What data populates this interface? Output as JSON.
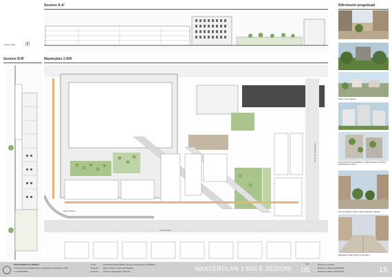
{
  "headings": {
    "section_aa": "Sezione A-A'",
    "references": "Riferimenti progettuali",
    "section_bb": "Sezione B-B'",
    "masterplan": "Masterplan 1:500"
  },
  "scale_label": "Scala 1:500",
  "references": [
    {
      "caption": ""
    },
    {
      "caption": ""
    },
    {
      "caption": "Adoro City, Nigeria"
    },
    {
      "caption": ""
    },
    {
      "caption": "Torrespaña Tisera Building - Fabio Eduardo Andrew - Emilio Ramon Riso"
    },
    {
      "caption": "Arki Gotenjaro, Plazas Santa Barbara, Madrid"
    },
    {
      "caption": "Exhibition Road South Kensington"
    }
  ],
  "streets": {
    "piazza": "Piazza Nizza",
    "corso_nizza": "Corso Nizza",
    "corso_sommeiller": "Corso G. Sommeiller"
  },
  "footer": {
    "school": "POLITECNICO DI TORINO",
    "course": "Corso di Laurea Magistrale in Architettura Costruzione Città",
    "year": "A.A. 2020/2021",
    "course_label": "Corso:",
    "course_value": "Architettura Sostenibile e Nuove Costruzioni A.A.2020/21",
    "student_label": "Studenti:",
    "student_value": "Pietro Doppio e Riccardo Rigaolo",
    "prof_label": "Docenti:",
    "prof_value": "Antonio Lapiccirella / Tadeusz",
    "title": "MASTERPLAN 1:500 E SEZIONI",
    "tav_label": "TAV",
    "tav_number": "05",
    "meta1": "Sezione: Livornesi",
    "meta2": "Revisione tavola: 18/06/2021",
    "meta3": "Revisione finale: 13/07/2021",
    "page_number": "15"
  },
  "colors": {
    "footer_bg": "#cfcfcf",
    "green": "#a9c58c",
    "orange": "#e8b27a",
    "building": "#eeeeee",
    "road": "#d6d6d6"
  }
}
